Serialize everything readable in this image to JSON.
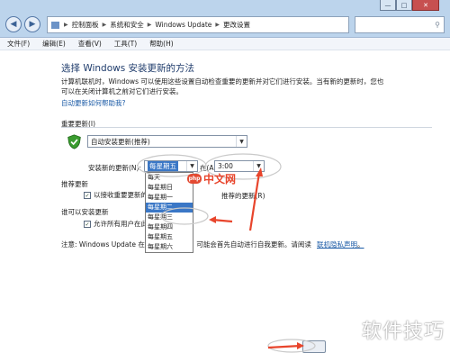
{
  "window": {
    "controls": [
      "—",
      "□",
      "✕"
    ],
    "back_icon": "back-arrow-icon",
    "forward_icon": "forward-arrow-icon",
    "breadcrumb": [
      "控制面板",
      "系统和安全",
      "Windows Update",
      "更改设置"
    ]
  },
  "menu": [
    "文件(F)",
    "编辑(E)",
    "查看(V)",
    "工具(T)",
    "帮助(H)"
  ],
  "page": {
    "heading": "选择 Windows 安装更新的方法",
    "intro_line1": "计算机联机时，Windows 可以使用这些设置自动检查重要的更新并对它们进行安装。当有新的更新时，您也",
    "intro_line2": "可以在关闭计算机之前对它们进行安装。",
    "intro_link": "自动更新如何帮助我?"
  },
  "important_updates": {
    "label": "重要更新(I)",
    "selected": "自动安装更新(推荐)",
    "install_day_label": "安装新的更新(N):",
    "install_day_selected": "每星期五",
    "at_label": "在(A)",
    "time_selected": "3:00",
    "day_options": [
      "每天",
      "每星期日",
      "每星期一",
      "每星期二",
      "每星期三",
      "每星期四",
      "每星期五",
      "每星期六"
    ],
    "highlighted_option": "每星期二"
  },
  "recommended_updates": {
    "label": "推荐更新",
    "checkbox_label": "以接收重要更新的",
    "checkbox_label_end": "推荐的更新(R)"
  },
  "who_can_install": {
    "label": "谁可以安装更新",
    "checkbox_label": "允许所有用户在此"
  },
  "note": {
    "prefix": "注意: Windows Update 在",
    "middle": "，可能会首先自动进行自我更新。请阅读",
    "link": "联机隐私声明",
    "suffix": "。"
  },
  "watermarks": {
    "php_badge": "php",
    "php_text": "中文网",
    "corner": "软件技巧"
  },
  "colors": {
    "accent": "#3a77c6",
    "annotation": "#e8452c"
  }
}
